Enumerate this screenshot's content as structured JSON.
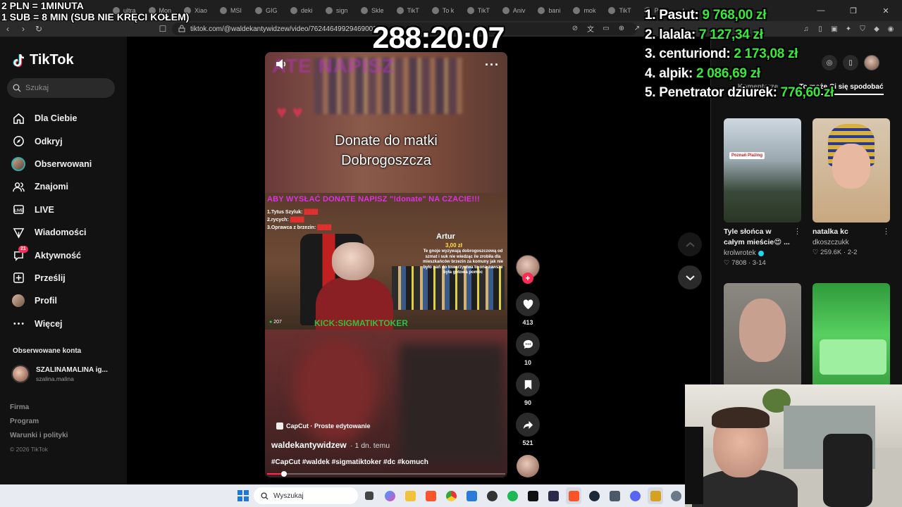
{
  "stream_overlay": {
    "line1": "2 PLN =  1MINUTA",
    "line2": "1 SUB = 8 MIN (SUB NIE KRĘCI KOŁEM)",
    "timer": "288:20:07"
  },
  "leaderboard": [
    {
      "rank": "1.",
      "name": "Pasut:",
      "amount": "9 768,00 zł"
    },
    {
      "rank": "2.",
      "name": "lalala:",
      "amount": "7 127,34 zł"
    },
    {
      "rank": "3.",
      "name": "centuriond:",
      "amount": "2 173,08 zł"
    },
    {
      "rank": "4.",
      "name": "alpik:",
      "amount": "2 086,69 zł"
    },
    {
      "rank": "5.",
      "name": "Penetrator dziurek:",
      "amount": "776,60 zł"
    }
  ],
  "browser": {
    "tabs": [
      {
        "label": "ultra"
      },
      {
        "label": "Mon"
      },
      {
        "label": "Xiao"
      },
      {
        "label": "MSI"
      },
      {
        "label": "GIG"
      },
      {
        "label": "deki"
      },
      {
        "label": "sign"
      },
      {
        "label": "Skle"
      },
      {
        "label": "TikT"
      },
      {
        "label": "To k"
      },
      {
        "label": "TikT"
      },
      {
        "label": "Aniv"
      },
      {
        "label": "bani"
      },
      {
        "label": "mok"
      },
      {
        "label": "TikT"
      },
      {
        "label": "Para"
      }
    ],
    "url": "tiktok.com/@waldekantywidzew/video/7624464992946900257",
    "colors": {
      "tab_bar": "#1f1f1f",
      "address_bar": "#2b2b2b"
    }
  },
  "sidebar": {
    "brand": "TikTok",
    "search_placeholder": "Szukaj",
    "items": [
      {
        "label": "Dla Ciebie",
        "icon": "home-icon"
      },
      {
        "label": "Odkryj",
        "icon": "compass-icon"
      },
      {
        "label": "Obserwowani",
        "icon": "avatar"
      },
      {
        "label": "Znajomi",
        "icon": "friends-icon"
      },
      {
        "label": "LIVE",
        "icon": "live-icon"
      },
      {
        "label": "Wiadomości",
        "icon": "send-icon"
      },
      {
        "label": "Aktywność",
        "icon": "activity-icon",
        "badge": "21"
      },
      {
        "label": "Prześlij",
        "icon": "upload-icon"
      },
      {
        "label": "Profil",
        "icon": "avatar"
      },
      {
        "label": "Więcej",
        "icon": "more-icon"
      }
    ],
    "followed_header": "Obserwowane konta",
    "followed": [
      {
        "name": "SZALINAMALINA ig...",
        "handle": "szalina.malina"
      }
    ],
    "footer": [
      "Firma",
      "Program",
      "Warunki i polityki"
    ],
    "copyright": "© 2026 TikTok"
  },
  "video": {
    "caption": [
      "Donate do matki",
      "Dobrogoszcza"
    ],
    "banner": "ABY WYSŁAĆ DONATE NAPISZ \"!donate\" NA CZACIE!!!",
    "donor_name": "Artur",
    "donor_amount": "3,00 zł",
    "board": [
      "1.Tytus Szyluk:",
      "2.rycych:",
      "3.Oprawca z brzezin:"
    ],
    "viewers": "207",
    "kick_text": "KICK:SIGMATIKTOKER",
    "capcut": "CapCut · Proste edytowanie",
    "author": "waldekantywidzew",
    "posted": "· 1 dn. temu",
    "hashtags": "#CapCut #waldek #sigmatiktoker #dc #komuch",
    "progress_fraction": 0.07
  },
  "actions": {
    "likes": "413",
    "comments": "10",
    "saves": "90",
    "shares": "521"
  },
  "right_panel": {
    "tabs": [
      "Komentarze",
      "To może Ci się spodobać"
    ],
    "cards": [
      {
        "title": "Tyle słońca w całym mieście😍 ...",
        "user": "krolwrotek",
        "verified": true,
        "likes": "7808",
        "date": "3-14",
        "tag": "Poznań Plażing"
      },
      {
        "title": "natalka kc",
        "user": "dkoszczukk",
        "verified": false,
        "likes": "259.6K",
        "date": "2-2"
      },
      {
        "title": "",
        "user": "",
        "likes": "",
        "date": ""
      },
      {
        "title": "",
        "user": "",
        "likes": "",
        "date": ""
      }
    ]
  },
  "taskbar": {
    "search_placeholder": "Wyszukaj"
  },
  "colors": {
    "tiktok_pink": "#fe2c55",
    "leaderboard_amount": "#38e83a",
    "banner_magenta": "#e030e0"
  }
}
